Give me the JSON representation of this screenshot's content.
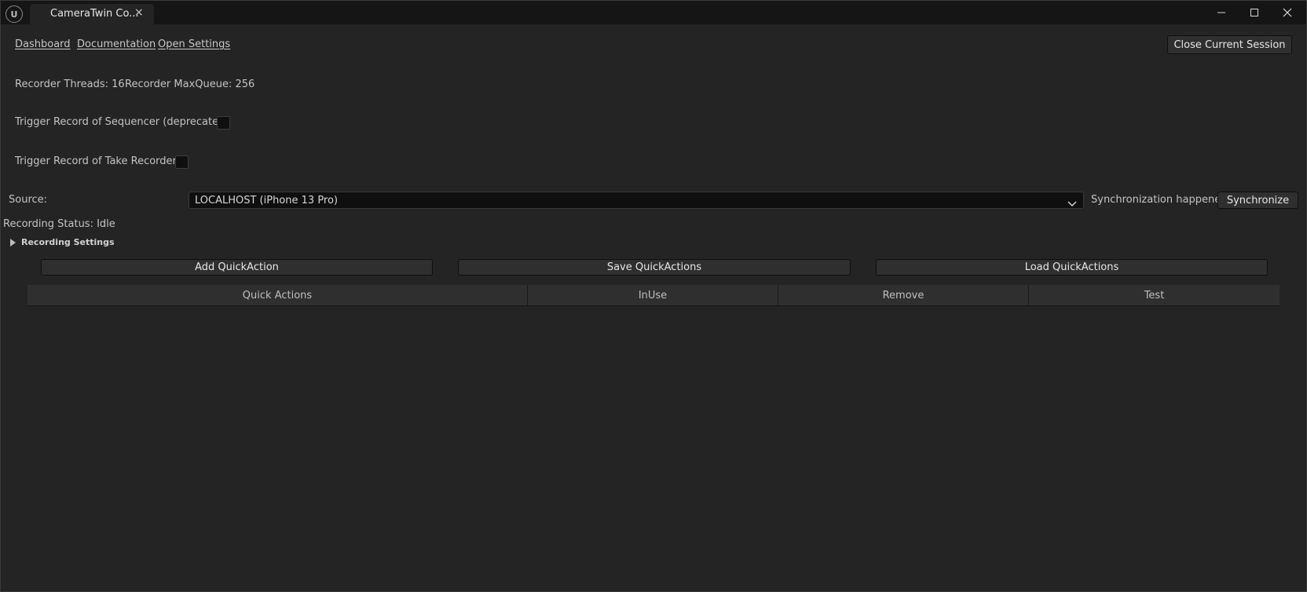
{
  "window": {
    "tab_title": "CameraTwin Co...",
    "tab_close": "×",
    "logo_glyph": "U"
  },
  "toolbar": {
    "links": [
      "Dashboard",
      "Documentation",
      "Open Settings"
    ],
    "close_session_label": "Close Current Session"
  },
  "recorder": {
    "threads_text": "Recorder Threads: 16",
    "maxqueue_text": "Recorder MaxQueue: 256"
  },
  "triggers": {
    "sequencer_label": "Trigger Record of Sequencer (deprecated)",
    "sequencer_checked": false,
    "take_recorder_label": "Trigger Record of Take Recorder",
    "take_recorder_checked": false
  },
  "source": {
    "label": "Source:",
    "selected": "LOCALHOST (iPhone 13 Pro)",
    "sync_status": "Synchronization happened",
    "sync_button": "Synchronize"
  },
  "status": {
    "recording_status": "Recording Status: Idle",
    "recording_settings": "Recording Settings"
  },
  "quick_actions": {
    "add_label": "Add QuickAction",
    "save_label": "Save QuickActions",
    "load_label": "Load QuickActions",
    "columns": [
      "Quick Actions",
      "InUse",
      "Remove",
      "Test"
    ]
  },
  "colors": {
    "background": "#242424",
    "titlebar": "#151515",
    "button": "#2f2f2f",
    "input": "#0f0f0f"
  }
}
